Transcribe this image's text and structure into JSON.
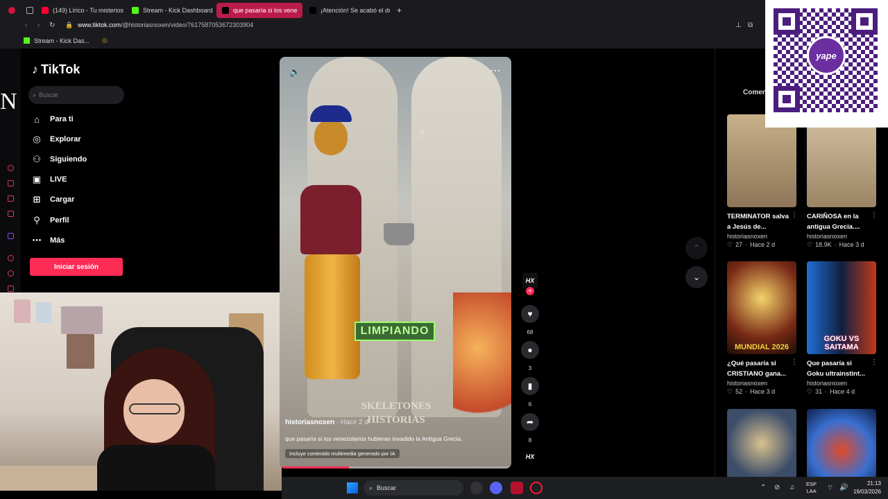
{
  "browser": {
    "tabs": [
      {
        "label": "(149) Lírico - Tu misterios",
        "color": "#ff0033"
      },
      {
        "label": "Stream - Kick Dashboard",
        "color": "#53fc18"
      },
      {
        "label": "que pasaría si los vene",
        "color": "#ffffff"
      },
      {
        "label": "¡Atención! Se acabó el dra",
        "color": "#ffffff"
      }
    ],
    "url_prefix": "www.tiktok.com",
    "url_path": "/@historiasnoxen/video/7617587053672303904",
    "bookmark": "Stream - Kick Das..."
  },
  "tiktok": {
    "logo": "TikTok",
    "search_placeholder": "Buscar",
    "nav": [
      {
        "label": "Para ti",
        "icon": "home-icon"
      },
      {
        "label": "Explorar",
        "icon": "compass-icon"
      },
      {
        "label": "Siguiendo",
        "icon": "person-icon"
      },
      {
        "label": "LIVE",
        "icon": "live-tv-icon"
      },
      {
        "label": "Cargar",
        "icon": "plus-square-icon"
      },
      {
        "label": "Perfil",
        "icon": "profile-icon"
      },
      {
        "label": "Más",
        "icon": "more-icon"
      }
    ],
    "login_label": "Iniciar sesión",
    "side_letter": "N"
  },
  "video": {
    "overlay_text": "LIMPIANDO",
    "watermark_line1": "SKELETONES",
    "watermark_line2": "HISTORIAS",
    "author": "historiasnoxen",
    "time": " · Hace 2 d",
    "caption": "que pasaría si los venezolanos hubieran invadido la Antigua Grecia.",
    "ai_label": "Incluye contenido multimedia generado por IA",
    "progress": 0.3,
    "avatar_text": "HX",
    "likes": "68",
    "comments": "3",
    "saves": "6",
    "shares": "8"
  },
  "right_panel": {
    "comments_tab": "Comen",
    "qr_brand": "yape",
    "cards": [
      {
        "title": "TERMINATOR salva a Jesús de...",
        "author": "historiasnoxen",
        "likes": "27",
        "time": "Hace 2 d",
        "label": ""
      },
      {
        "title": "CARIÑOSA en la antigua Grecia....",
        "author": "historiasnoxen",
        "likes": "18.9K",
        "time": "Hace 3 d",
        "label": ""
      },
      {
        "title": "¿Qué pasaría si CRISTIANO gana...",
        "author": "historiasnoxen",
        "likes": "52",
        "time": "Hace 3 d",
        "label": "MUNDIAL 2026"
      },
      {
        "title": "Que pasaría si Goku ultrainstint...",
        "author": "historiasnoxen",
        "likes": "31",
        "time": "Hace 4 d",
        "label": "GOKU VS SAITAMA"
      },
      {
        "title": "",
        "author": "",
        "likes": "",
        "time": "",
        "label": ""
      },
      {
        "title": "",
        "author": "",
        "likes": "",
        "time": "",
        "label": ""
      }
    ]
  },
  "taskbar": {
    "search": "Buscar",
    "lang1": "ESP",
    "lang2": "LAA",
    "time": "21:13",
    "date": "19/03/2026"
  }
}
